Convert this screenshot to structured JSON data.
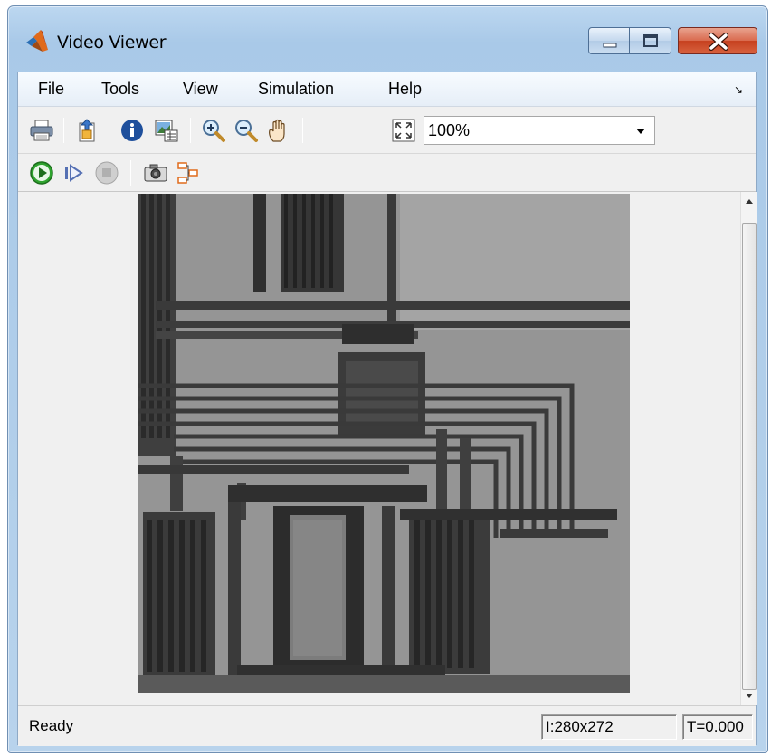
{
  "window": {
    "title": "Video Viewer",
    "icon": "matlab-icon"
  },
  "title_buttons": {
    "minimize_icon": "minimize-icon",
    "maximize_icon": "maximize-icon",
    "close_icon": "close-icon"
  },
  "menu": {
    "items": [
      "File",
      "Tools",
      "View",
      "Simulation",
      "Help"
    ],
    "overflow_arrow": "↘"
  },
  "toolbar1": {
    "icons": [
      "print-icon",
      "export-icon",
      "info-icon",
      "image-properties-icon",
      "zoom-in-icon",
      "zoom-out-icon",
      "pan-hand-icon",
      "fit-to-window-icon"
    ],
    "zoom_value": "100%"
  },
  "toolbar2": {
    "icons": [
      "play-icon",
      "step-forward-icon",
      "stop-icon",
      "snapshot-icon",
      "highlight-model-icon"
    ]
  },
  "status": {
    "ready": "Ready",
    "dimensions": "I:280x272",
    "time": "T=0.000"
  },
  "colors": {
    "title_gradient_top": "#bcd7f0",
    "close_button": "#c6401f",
    "play_green": "#2ea32e",
    "chassis": "#f0f0f0"
  }
}
